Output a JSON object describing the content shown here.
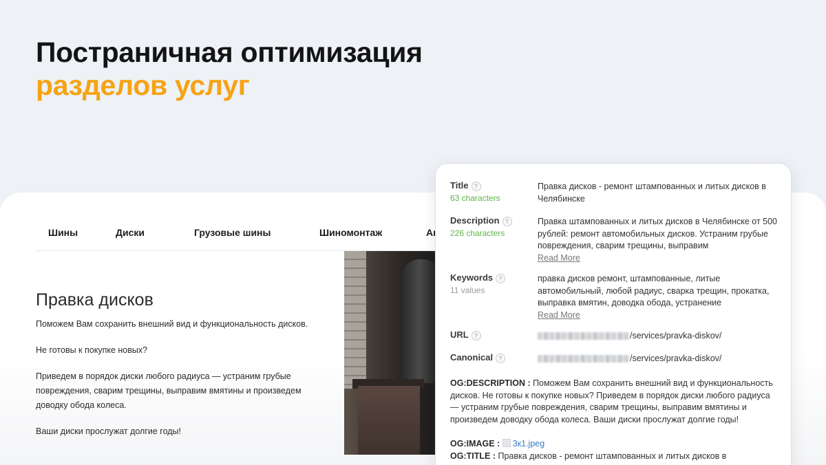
{
  "hero": {
    "title_line1": "Постраничная оптимизация",
    "title_line2": "разделов услуг",
    "accent_color": "#f6a313"
  },
  "site": {
    "nav": [
      "Шины",
      "Диски",
      "Грузовые шины",
      "Шиномонтаж",
      "Ак"
    ],
    "heading": "Правка дисков",
    "paragraphs": [
      "Поможем Вам сохранить внешний вид и функциональность дисков.",
      "Не готовы к покупке новых?",
      "Приведем в порядок диски любого радиуса — устраним грубые повреждения, сварим трещины, выправим вмятины и произведем доводку обода колеса.",
      "Ваши диски прослужат долгие годы!"
    ]
  },
  "seo": {
    "title": {
      "label": "Title",
      "sub": "63 characters",
      "value": "Правка дисков - ремонт штампованных и литых дисков в Челябинске"
    },
    "description": {
      "label": "Description",
      "sub": "226 characters",
      "value": "Правка штампованных и литых дисков в Челябинске от 500 рублей: ремонт автомобильных дисков. Устраним грубые повреждения, сварим трещины, выправим",
      "read_more": "Read More"
    },
    "keywords": {
      "label": "Keywords",
      "sub": "11 values",
      "value": "правка дисков ремонт, штампованные, литые автомобильный, любой радиус, сварка трещин, прокатка, выправка вмятин, доводка обода, устранение",
      "read_more": "Read More"
    },
    "url": {
      "label": "URL",
      "path": "/services/pravka-diskov/"
    },
    "canonical": {
      "label": "Canonical",
      "path": "/services/pravka-diskov/"
    },
    "og_description": {
      "label": "OG:DESCRIPTION :",
      "value": "Поможем Вам сохранить внешний вид и функциональность дисков. Не готовы к покупке новых? Приведем в порядок диски любого радиуса — устраним грубые повреждения, сварим трещины, выправим вмятины и произведем доводку обода колеса. Ваши диски прослужат долгие годы!"
    },
    "og_image": {
      "label": "OG:IMAGE :",
      "file": "3к1.jpeg"
    },
    "og_title": {
      "label": "OG:TITLE :",
      "value": "Правка дисков - ремонт штампованных и литых дисков в"
    },
    "help_glyph": "?",
    "green": "#5fb346"
  }
}
